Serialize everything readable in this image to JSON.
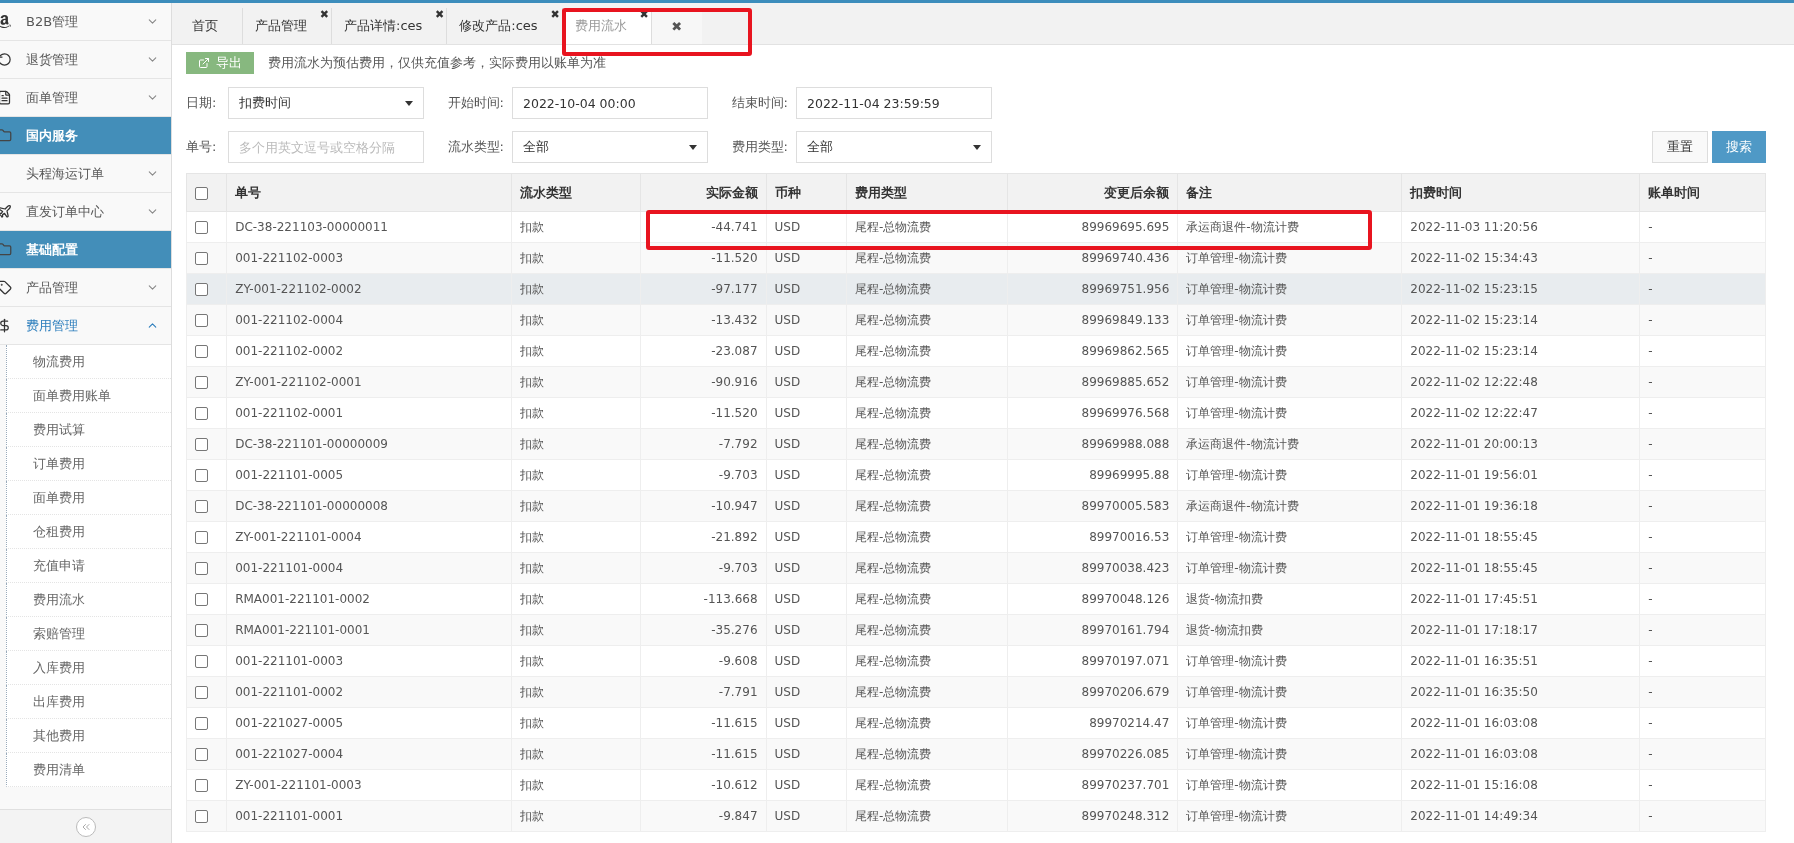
{
  "sidebar": {
    "items": [
      {
        "label": "B2B管理",
        "kind": "menu",
        "expanded": false
      },
      {
        "label": "退货管理",
        "kind": "menu",
        "expanded": false
      },
      {
        "label": "面单管理",
        "kind": "menu",
        "expanded": false
      },
      {
        "label": "国内服务",
        "kind": "section"
      },
      {
        "label": "头程海运订单",
        "kind": "menu",
        "expanded": false
      },
      {
        "label": "直发订单中心",
        "kind": "menu",
        "expanded": false
      },
      {
        "label": "基础配置",
        "kind": "section"
      },
      {
        "label": "产品管理",
        "kind": "menu",
        "expanded": false
      },
      {
        "label": "费用管理",
        "kind": "menu",
        "expanded": true,
        "children": [
          {
            "label": "物流费用"
          },
          {
            "label": "面单费用账单"
          },
          {
            "label": "费用试算"
          },
          {
            "label": "订单费用"
          },
          {
            "label": "面单费用"
          },
          {
            "label": "仓租费用"
          },
          {
            "label": "充值申请"
          },
          {
            "label": "费用流水"
          },
          {
            "label": "索赔管理"
          },
          {
            "label": "入库费用"
          },
          {
            "label": "出库费用"
          },
          {
            "label": "其他费用"
          },
          {
            "label": "费用清单"
          }
        ]
      }
    ]
  },
  "tabs": [
    {
      "label": "首页",
      "selected": false,
      "kind": "tab"
    },
    {
      "label": "产品管理",
      "selected": false,
      "kind": "tab",
      "close": "✖"
    },
    {
      "label": "产品详情:ces",
      "selected": false,
      "kind": "tab",
      "close": "✖"
    },
    {
      "label": "修改产品:ces",
      "selected": false,
      "kind": "tab",
      "close": "✖"
    },
    {
      "label": "费用流水",
      "selected": true,
      "kind": "tab",
      "close": "✖"
    },
    {
      "label": "✖",
      "selected": false,
      "kind": "close-all"
    }
  ],
  "toolbar": {
    "export_label": "导出",
    "notice": "费用流水为预估费用，仅供充值参考，实际费用以账单为准"
  },
  "filters": [
    [
      {
        "label": "日期:",
        "kind": "select",
        "value": "扣费时间"
      },
      {
        "label": "开始时间:",
        "kind": "input",
        "value": "2022-10-04 00:00"
      },
      {
        "label": "结束时间:",
        "kind": "input",
        "value": "2022-11-04 23:59:59"
      }
    ],
    [
      {
        "label": "单号:",
        "kind": "input",
        "placeholder": "多个用英文逗号或空格分隔"
      },
      {
        "label": "流水类型:",
        "kind": "select",
        "value": "全部"
      },
      {
        "label": "费用类型:",
        "kind": "select",
        "value": "全部"
      }
    ]
  ],
  "buttons": {
    "reset": "重置",
    "search": "搜索"
  },
  "table": {
    "header_checked": false,
    "columns": [
      "单号",
      "流水类型",
      "实际金额",
      "币种",
      "费用类型",
      "变更后余额",
      "备注",
      "扣费时间",
      "账单时间"
    ],
    "rows": [
      {
        "checked": false,
        "highlighted": false,
        "cells": [
          "DC-38-221103-00000011",
          "扣款",
          "-44.741",
          "USD",
          "尾程-总物流费",
          "89969695.695",
          "承运商退件-物流计费",
          "2022-11-03 11:20:56",
          "-"
        ]
      },
      {
        "checked": false,
        "highlighted": false,
        "cells": [
          "001-221102-0003",
          "扣款",
          "-11.520",
          "USD",
          "尾程-总物流费",
          "89969740.436",
          "订单管理-物流计费",
          "2022-11-02 15:34:43",
          "-"
        ]
      },
      {
        "checked": false,
        "highlighted": true,
        "cells": [
          "ZY-001-221102-0002",
          "扣款",
          "-97.177",
          "USD",
          "尾程-总物流费",
          "89969751.956",
          "订单管理-物流计费",
          "2022-11-02 15:23:15",
          "-"
        ]
      },
      {
        "checked": false,
        "highlighted": false,
        "cells": [
          "001-221102-0004",
          "扣款",
          "-13.432",
          "USD",
          "尾程-总物流费",
          "89969849.133",
          "订单管理-物流计费",
          "2022-11-02 15:23:14",
          "-"
        ]
      },
      {
        "checked": false,
        "highlighted": false,
        "cells": [
          "001-221102-0002",
          "扣款",
          "-23.087",
          "USD",
          "尾程-总物流费",
          "89969862.565",
          "订单管理-物流计费",
          "2022-11-02 15:23:14",
          "-"
        ]
      },
      {
        "checked": false,
        "highlighted": false,
        "cells": [
          "ZY-001-221102-0001",
          "扣款",
          "-90.916",
          "USD",
          "尾程-总物流费",
          "89969885.652",
          "订单管理-物流计费",
          "2022-11-02 12:22:48",
          "-"
        ]
      },
      {
        "checked": false,
        "highlighted": false,
        "cells": [
          "001-221102-0001",
          "扣款",
          "-11.520",
          "USD",
          "尾程-总物流费",
          "89969976.568",
          "订单管理-物流计费",
          "2022-11-02 12:22:47",
          "-"
        ]
      },
      {
        "checked": false,
        "highlighted": false,
        "cells": [
          "DC-38-221101-00000009",
          "扣款",
          "-7.792",
          "USD",
          "尾程-总物流费",
          "89969988.088",
          "承运商退件-物流计费",
          "2022-11-01 20:00:13",
          "-"
        ]
      },
      {
        "checked": false,
        "highlighted": false,
        "cells": [
          "001-221101-0005",
          "扣款",
          "-9.703",
          "USD",
          "尾程-总物流费",
          "89969995.88",
          "订单管理-物流计费",
          "2022-11-01 19:56:01",
          "-"
        ]
      },
      {
        "checked": false,
        "highlighted": false,
        "cells": [
          "DC-38-221101-00000008",
          "扣款",
          "-10.947",
          "USD",
          "尾程-总物流费",
          "89970005.583",
          "承运商退件-物流计费",
          "2022-11-01 19:36:18",
          "-"
        ]
      },
      {
        "checked": false,
        "highlighted": false,
        "cells": [
          "ZY-001-221101-0004",
          "扣款",
          "-21.892",
          "USD",
          "尾程-总物流费",
          "89970016.53",
          "订单管理-物流计费",
          "2022-11-01 18:55:45",
          "-"
        ]
      },
      {
        "checked": false,
        "highlighted": false,
        "cells": [
          "001-221101-0004",
          "扣款",
          "-9.703",
          "USD",
          "尾程-总物流费",
          "89970038.423",
          "订单管理-物流计费",
          "2022-11-01 18:55:45",
          "-"
        ]
      },
      {
        "checked": false,
        "highlighted": false,
        "cells": [
          "RMA001-221101-0002",
          "扣款",
          "-113.668",
          "USD",
          "尾程-总物流费",
          "89970048.126",
          "退货-物流扣费",
          "2022-11-01 17:45:51",
          "-"
        ]
      },
      {
        "checked": false,
        "highlighted": false,
        "cells": [
          "RMA001-221101-0001",
          "扣款",
          "-35.276",
          "USD",
          "尾程-总物流费",
          "89970161.794",
          "退货-物流扣费",
          "2022-11-01 17:18:17",
          "-"
        ]
      },
      {
        "checked": false,
        "highlighted": false,
        "cells": [
          "001-221101-0003",
          "扣款",
          "-9.608",
          "USD",
          "尾程-总物流费",
          "89970197.071",
          "订单管理-物流计费",
          "2022-11-01 16:35:51",
          "-"
        ]
      },
      {
        "checked": false,
        "highlighted": false,
        "cells": [
          "001-221101-0002",
          "扣款",
          "-7.791",
          "USD",
          "尾程-总物流费",
          "89970206.679",
          "订单管理-物流计费",
          "2022-11-01 16:35:50",
          "-"
        ]
      },
      {
        "checked": false,
        "highlighted": false,
        "cells": [
          "001-221027-0005",
          "扣款",
          "-11.615",
          "USD",
          "尾程-总物流费",
          "89970214.47",
          "订单管理-物流计费",
          "2022-11-01 16:03:08",
          "-"
        ]
      },
      {
        "checked": false,
        "highlighted": false,
        "cells": [
          "001-221027-0004",
          "扣款",
          "-11.615",
          "USD",
          "尾程-总物流费",
          "89970226.085",
          "订单管理-物流计费",
          "2022-11-01 16:03:08",
          "-"
        ]
      },
      {
        "checked": false,
        "highlighted": false,
        "cells": [
          "ZY-001-221101-0003",
          "扣款",
          "-10.612",
          "USD",
          "尾程-总物流费",
          "89970237.701",
          "订单管理-物流计费",
          "2022-11-01 15:16:08",
          "-"
        ]
      },
      {
        "checked": false,
        "highlighted": false,
        "cells": [
          "001-221101-0001",
          "扣款",
          "-9.847",
          "USD",
          "尾程-总物流费",
          "89970248.312",
          "订单管理-物流计费",
          "2022-11-01 14:49:34",
          "-"
        ]
      }
    ]
  }
}
